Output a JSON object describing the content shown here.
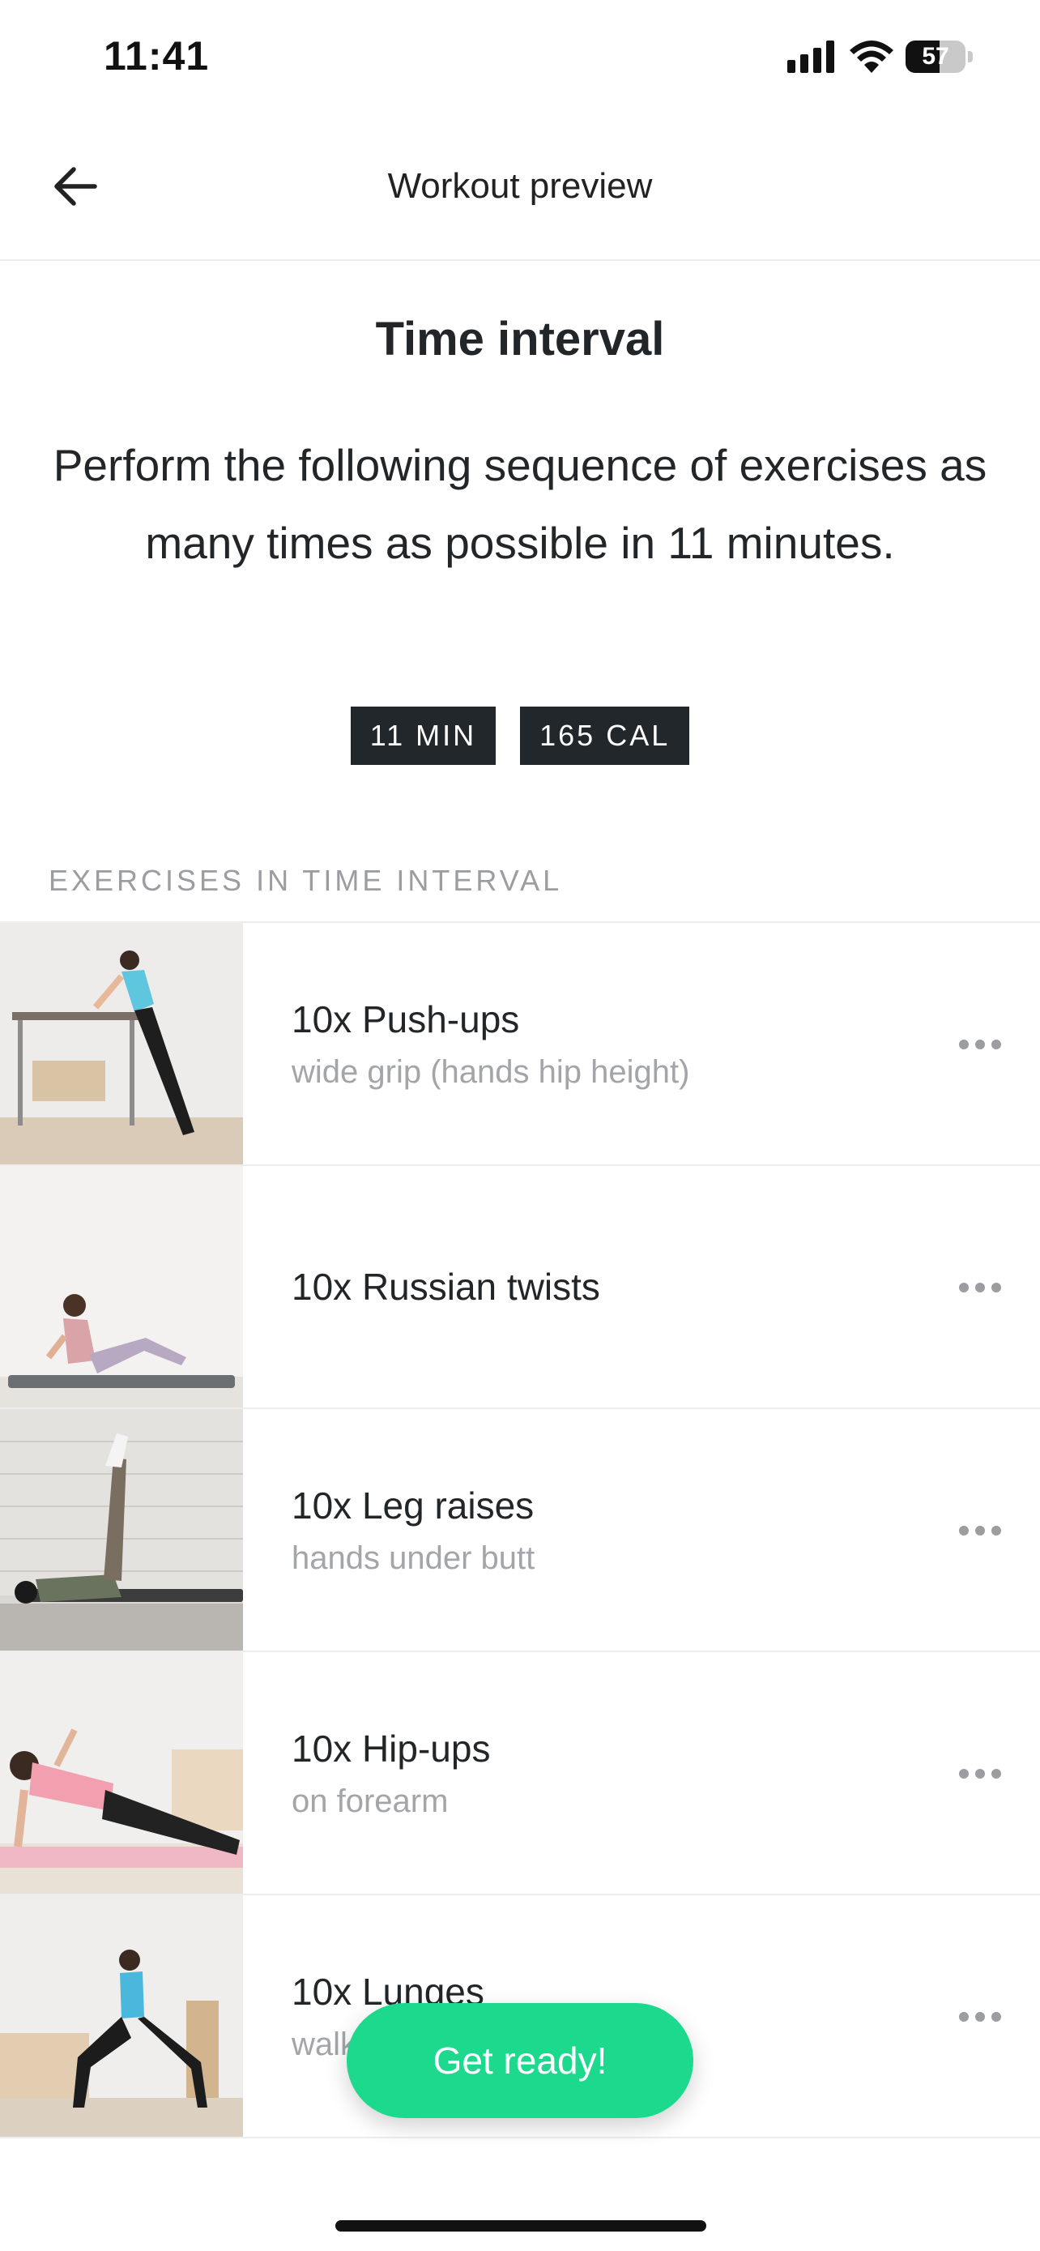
{
  "status_bar": {
    "time": "11:41",
    "battery_level": "57",
    "battery_fraction": 0.57,
    "icons": [
      "signal-icon",
      "wifi-icon",
      "battery-icon"
    ]
  },
  "nav": {
    "title": "Workout preview",
    "back_icon": "arrow-left-icon"
  },
  "workout": {
    "title": "Time interval",
    "description": "Perform the following sequence of exercises as many times as possible in 11 minutes.",
    "badges": {
      "duration": "11 MIN",
      "calories": "165 CAL"
    }
  },
  "section_header": "EXERCISES IN TIME INTERVAL",
  "exercises": [
    {
      "name": "10x Push-ups",
      "detail": "wide grip (hands hip height)"
    },
    {
      "name": "10x Russian twists",
      "detail": ""
    },
    {
      "name": "10x Leg raises",
      "detail": "hands under butt"
    },
    {
      "name": "10x Hip-ups",
      "detail": "on forearm"
    },
    {
      "name": "10x Lunges",
      "detail": "walking"
    }
  ],
  "cta": {
    "label": "Get ready!"
  },
  "colors": {
    "accent": "#1cd98e",
    "badge_bg": "#22272b",
    "text": "#222629",
    "muted": "#a3a5a8"
  }
}
